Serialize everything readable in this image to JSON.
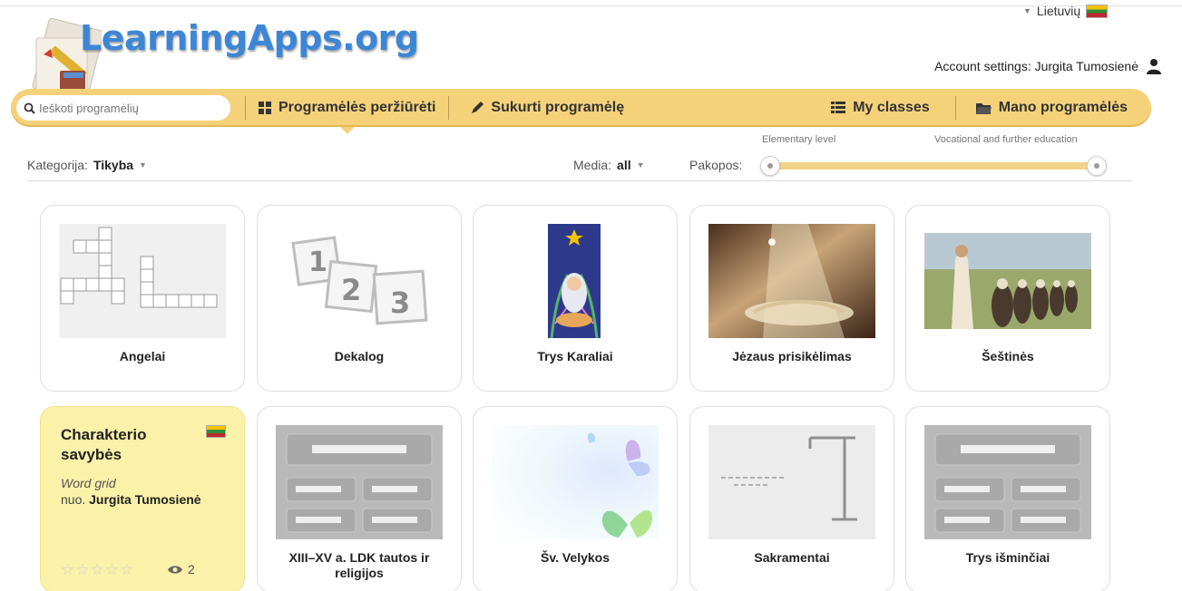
{
  "header": {
    "logo_text": "LearningApps.org",
    "language": "Lietuvių",
    "account_label": "Account settings: Jurgita Tumosienė"
  },
  "nav": {
    "search_placeholder": "Ieškoti programėlių",
    "browse": "Programėlės peržiūrėti",
    "create": "Sukurti programėlę",
    "classes": "My classes",
    "my_apps": "Mano programėlės"
  },
  "filters": {
    "category_label": "Kategorija:",
    "category_value": "Tikyba",
    "media_label": "Media:",
    "media_value": "all",
    "levels_label": "Pakopos:",
    "level_min_label": "Elementary level",
    "level_max_label": "Vocational and further education"
  },
  "apps": [
    {
      "title": "Angelai",
      "thumb": "crossword"
    },
    {
      "title": "Dekalog",
      "thumb": "numbers"
    },
    {
      "title": "Trys Karaliai",
      "thumb": "nativity"
    },
    {
      "title": "Jėzaus prisikėlimas",
      "thumb": "tomb"
    },
    {
      "title": "Šeštinės",
      "thumb": "painting"
    },
    {
      "title": "Charakterio savybės",
      "type": "Word grid",
      "by_label": "nuo.",
      "author": "Jurgita Tumosienė",
      "stars": "☆☆☆☆☆",
      "views": "2",
      "highlighted": true
    },
    {
      "title": "XIII–XV a. LDK tautos ir religijos",
      "thumb": "layout"
    },
    {
      "title": "Šv. Velykos",
      "thumb": "butterflies"
    },
    {
      "title": "Sakramentai",
      "thumb": "hangman"
    },
    {
      "title": "Trys išminčiai",
      "thumb": "layout"
    }
  ],
  "colors": {
    "navbar": "#f5d27a",
    "logo": "#3d86d6",
    "highlight_card": "#fbf1a9"
  }
}
